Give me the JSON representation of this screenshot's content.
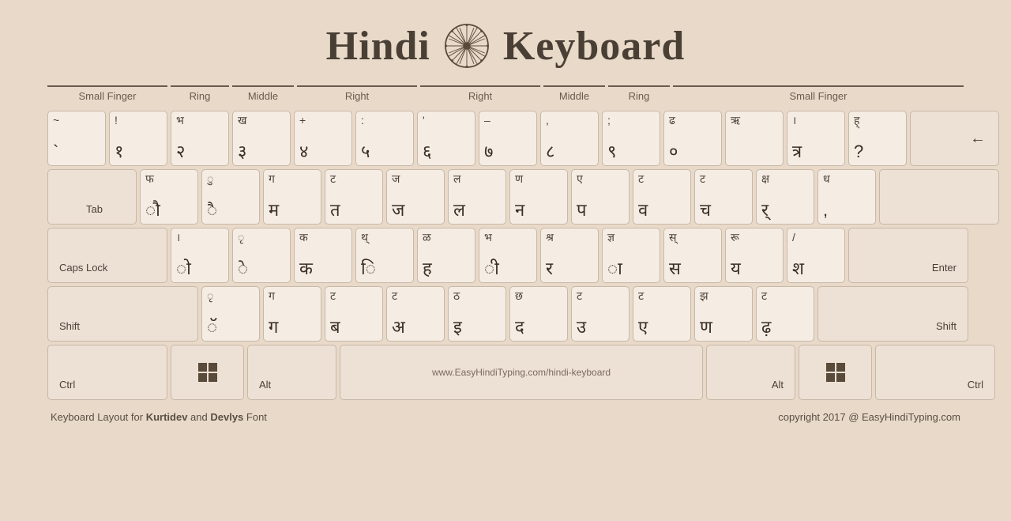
{
  "title": {
    "part1": "Hindi",
    "part2": "Keyboard",
    "subtitle": "Keyboard Layout"
  },
  "finger_labels": [
    {
      "label": "Small Finger",
      "class": "fl-small1"
    },
    {
      "label": "Ring",
      "class": "fl-ring1"
    },
    {
      "label": "Middle",
      "class": "fl-middle1"
    },
    {
      "label": "Right",
      "class": "fl-right1"
    },
    {
      "label": "Right",
      "class": "fl-right2"
    },
    {
      "label": "Middle",
      "class": "fl-middle2"
    },
    {
      "label": "Ring",
      "class": "fl-ring2"
    },
    {
      "label": "Small Finger",
      "class": "fl-small2"
    }
  ],
  "rows": {
    "row1": [
      {
        "top": "~",
        "bottom": "`",
        "w": "w1"
      },
      {
        "top": "!",
        "bottom": "१",
        "w": "w1"
      },
      {
        "top": "भ",
        "bottom": "२",
        "w": "w1"
      },
      {
        "top": "ख",
        "bottom": "३",
        "w": "w1"
      },
      {
        "top": "+",
        "bottom": "४",
        "w": "w1"
      },
      {
        "top": ":",
        "bottom": "५",
        "w": "w1"
      },
      {
        "top": "'",
        "bottom": "६",
        "w": "w1"
      },
      {
        "top": "–",
        "bottom": "७",
        "w": "w1"
      },
      {
        "top": ",",
        "bottom": "८",
        "w": "w1"
      },
      {
        "top": ";",
        "bottom": "९",
        "w": "w1"
      },
      {
        "top": "ढ",
        "bottom": "०",
        "w": "w1"
      },
      {
        "top": "ऋ",
        "bottom": "",
        "w": "w1"
      },
      {
        "top": "।",
        "bottom": "त्र",
        "w": "w1"
      },
      {
        "top": "ह्",
        "bottom": "?",
        "w": "w1"
      },
      {
        "label": "←",
        "special": true,
        "w": "w-backspace"
      }
    ],
    "row2": [
      {
        "label": "Tab",
        "special": true,
        "w": "w-tab"
      },
      {
        "top": "फ",
        "bottom": "ौ",
        "w": "w1"
      },
      {
        "top": "ु",
        "bottom": "ै",
        "w": "w1"
      },
      {
        "top": "ग",
        "bottom": "म",
        "w": "w1"
      },
      {
        "top": "ट",
        "bottom": "त",
        "w": "w1"
      },
      {
        "top": "ज",
        "bottom": "ज",
        "w": "w1"
      },
      {
        "top": "ल",
        "bottom": "ल",
        "w": "w1"
      },
      {
        "top": "ण",
        "bottom": "न",
        "w": "w1"
      },
      {
        "top": "ए",
        "bottom": "प",
        "w": "w1"
      },
      {
        "top": "ट",
        "bottom": "व",
        "w": "w1"
      },
      {
        "top": "ट",
        "bottom": "च",
        "w": "w1"
      },
      {
        "top": "क्ष",
        "bottom": "र्",
        "w": "w1"
      },
      {
        "top": "ध",
        "bottom": ",",
        "w": "w1"
      },
      {
        "label": "",
        "special": true,
        "enter_top": true,
        "w": "w-enter"
      }
    ],
    "row3": [
      {
        "label": "Caps Lock",
        "special": true,
        "w": "w-caps"
      },
      {
        "top": "।",
        "bottom": "ो",
        "w": "w1"
      },
      {
        "top": "ृ",
        "bottom": "े",
        "w": "w1"
      },
      {
        "top": "क",
        "bottom": "क",
        "w": "w1"
      },
      {
        "top": "थ्",
        "bottom": "ि",
        "w": "w1"
      },
      {
        "top": "ळ",
        "bottom": "ह",
        "w": "w1"
      },
      {
        "top": "भ",
        "bottom": "ी",
        "w": "w1"
      },
      {
        "top": "श्र",
        "bottom": "र",
        "w": "w1"
      },
      {
        "top": "ज्ञ",
        "bottom": "ा",
        "w": "w1"
      },
      {
        "top": "स्",
        "bottom": "स",
        "w": "w1"
      },
      {
        "top": "रू",
        "bottom": "य",
        "w": "w1"
      },
      {
        "top": "/",
        "bottom": "श",
        "w": "w1"
      },
      {
        "label": "Enter",
        "special": true,
        "w": "w-enter"
      }
    ],
    "row4": [
      {
        "label": "Shift",
        "special": true,
        "w": "w-shift-l"
      },
      {
        "top": "ृ",
        "bottom": "ॅ",
        "w": "w1"
      },
      {
        "top": "ग",
        "bottom": "ग",
        "w": "w1"
      },
      {
        "top": "ट",
        "bottom": "ब",
        "w": "w1"
      },
      {
        "top": "ट",
        "bottom": "अ",
        "w": "w1"
      },
      {
        "top": "ठ",
        "bottom": "इ",
        "w": "w1"
      },
      {
        "top": "छ",
        "bottom": "द",
        "w": "w1"
      },
      {
        "top": "ट",
        "bottom": "उ",
        "w": "w1"
      },
      {
        "top": "ट",
        "bottom": "ए",
        "w": "w1"
      },
      {
        "top": "झ",
        "bottom": "ण",
        "w": "w1"
      },
      {
        "top": "ट",
        "bottom": "ढ़",
        "w": "w1"
      },
      {
        "label": "Shift",
        "special": true,
        "w": "w-shift-r"
      }
    ],
    "row5": [
      {
        "label": "Ctrl",
        "special": true,
        "w": "w-ctrl"
      },
      {
        "label": "win",
        "special": true,
        "icon": true,
        "w": "w-win"
      },
      {
        "label": "Alt",
        "special": true,
        "w": "w-alt"
      },
      {
        "label": "www.EasyHindiTyping.com/hindi-keyboard",
        "special": true,
        "space": true,
        "w": "w-space"
      },
      {
        "label": "Alt",
        "special": true,
        "w": "w-alt"
      },
      {
        "label": "win2",
        "special": true,
        "icon": true,
        "w": "w-win"
      },
      {
        "label": "Ctrl",
        "special": true,
        "w": "w-ctrl"
      }
    ]
  },
  "footer": {
    "left": "Keyboard Layout for Kurtidev and Devlys Font",
    "right": "copyright 2017 @ EasyHindiTyping.com"
  }
}
